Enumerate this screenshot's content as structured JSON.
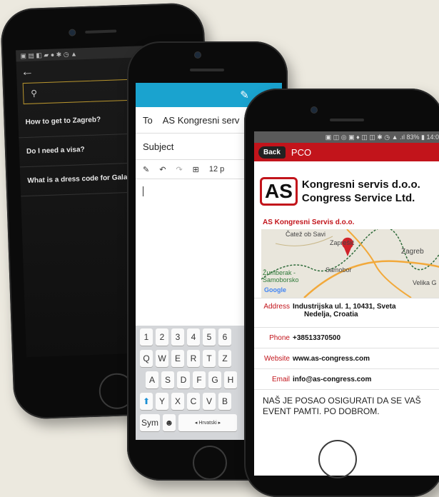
{
  "phone1": {
    "status_icons": "▣ ▤ ◧ ▰   ● ✱ ◷ ▲",
    "back_icon": "arrow-left-icon",
    "search_placeholder": "",
    "faq": [
      {
        "label": "How to get to Zagreb?"
      },
      {
        "label": "Do I need a visa?"
      },
      {
        "label": "What is a dress code for Gala Di"
      }
    ]
  },
  "phone2": {
    "to_label": "To",
    "to_value": "AS Kongresni serv",
    "subject_label": "Subject",
    "font_size": "12 p",
    "keyboard": {
      "row0": [
        "1",
        "2",
        "3",
        "4",
        "5",
        "6"
      ],
      "row1": [
        "Q",
        "W",
        "E",
        "R",
        "T",
        "Z"
      ],
      "row2": [
        "A",
        "S",
        "D",
        "F",
        "G",
        "H"
      ],
      "row3": [
        "Y",
        "X",
        "C",
        "V",
        "B"
      ],
      "sym": "Sym",
      "space_label": "◂ Hrvatski ▸"
    }
  },
  "phone3": {
    "status": "▣ ◫ ◎ ▣ ♦ ◫ ◫ ✱ ◷ ▲ .ıl 83% ▮ 14:08",
    "back_label": "Back",
    "title": "PCO",
    "logo_mark": "AS",
    "logo_line1": "Kongresni servis d.o.o.",
    "logo_line2": "Congress Service Ltd.",
    "company": "AS Kongresni Servis d.o.o.",
    "map_labels": {
      "catez": "Čatež ob Savi",
      "zapresic": "Zaprešić",
      "zagreb": "Zagreb",
      "samobor": "Samobor",
      "zumberak": "Žumberak -",
      "samoborsko": "Samoborsko",
      "velika": "Velika G",
      "google": "Google"
    },
    "address_label": "Address",
    "address_value_1": "Industrijska ul. 1, 10431, Sveta",
    "address_value_2": "Nedelja, Croatia",
    "phone_label": "Phone",
    "phone_value": "+38513370500",
    "website_label": "Website",
    "website_value": "www.as-congress.com",
    "email_label": "Email",
    "email_value": "info@as-congress.com",
    "motto": "NAŠ JE POSAO OSIGURATI DA SE VAŠ EVENT PAMTI. PO DOBROM."
  },
  "colors": {
    "accent_red": "#c2141b",
    "accent_blue": "#1aa3cf",
    "search_border": "#b8952e"
  }
}
